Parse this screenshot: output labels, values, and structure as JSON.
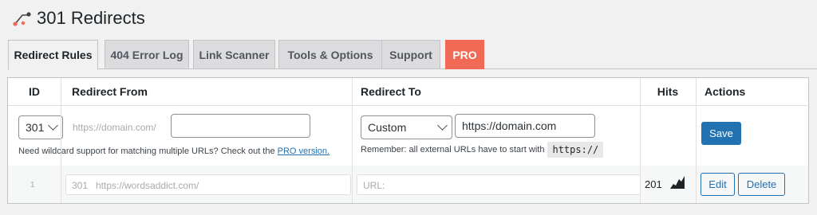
{
  "header": {
    "title": "301 Redirects"
  },
  "tabs": [
    {
      "label": "Redirect Rules",
      "active": true
    },
    {
      "label": "404 Error Log"
    },
    {
      "label": "Link Scanner"
    },
    {
      "label": "Tools & Options"
    },
    {
      "label": "Support"
    },
    {
      "label": "PRO"
    }
  ],
  "table": {
    "columns": [
      "ID",
      "Redirect From",
      "Redirect To",
      "Hits",
      "Actions"
    ],
    "new_rule": {
      "status_code": "301",
      "from_prefix": "https://domain.com/",
      "from_value": "",
      "help_from_text": "Need wildcard support for matching multiple URLs? Check out the ",
      "help_from_link": "PRO version.",
      "target_type": "Custom",
      "to_value": "https://domain.com",
      "help_to_text": "Remember: all external URLs have to start with",
      "help_to_code": "https://",
      "save_label": "Save"
    },
    "rows": [
      {
        "id": "1",
        "status_code": "301",
        "from_prefix": "https://wordsaddict.com/",
        "to_prefix": "URL:",
        "hits": "201",
        "edit_label": "Edit",
        "delete_label": "Delete"
      }
    ]
  },
  "colors": {
    "accent": "#2271b1",
    "pro": "#f06a56"
  },
  "icons": {
    "logo": "redirect-logo-icon",
    "hits": "hits-chart-icon"
  }
}
